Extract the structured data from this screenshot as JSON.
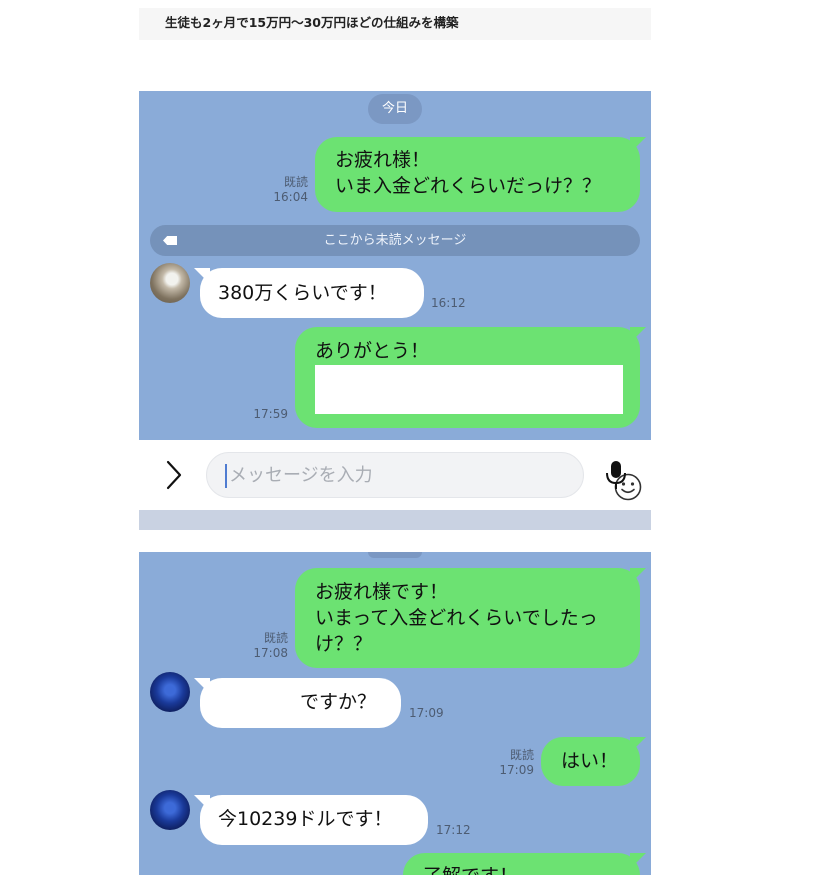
{
  "caption": "生徒も2ヶ月で15万円〜30万円ほどの仕組みを構築",
  "chat1": {
    "date_badge": "今日",
    "msg1": {
      "lines": [
        "お疲れ様！",
        "いま入金どれくらいだっけ？？"
      ],
      "read": "既読",
      "time": "16:04"
    },
    "unread_divider": "ここから未読メッセージ",
    "msg2": {
      "text": "380万くらいです！",
      "time": "16:12"
    },
    "msg3": {
      "text": "ありがとう！",
      "time": "17:59"
    }
  },
  "input_bar": {
    "placeholder": "メッセージを入力",
    "icons": [
      "chevron-right-icon",
      "smiley-icon",
      "microphone-icon"
    ]
  },
  "chat2": {
    "msg1": {
      "lines": [
        "お疲れ様です！",
        "いまって入金どれくらいでしたっ",
        "け？？"
      ],
      "read": "既読",
      "time": "17:08"
    },
    "msg2": {
      "text": "ですか？",
      "time": "17:09"
    },
    "msg3": {
      "text": "はい！",
      "read": "既読",
      "time": "17:09"
    },
    "msg4": {
      "text": "今10239ドルです！",
      "time": "17:12"
    },
    "msg5": {
      "text": "了解です！"
    }
  },
  "colors": {
    "chat_bg": "#8aabd8",
    "outgoing_bubble": "#6ce272",
    "incoming_bubble": "#ffffff",
    "badge": "#7b98c3",
    "cursor": "#4f7cd1"
  }
}
